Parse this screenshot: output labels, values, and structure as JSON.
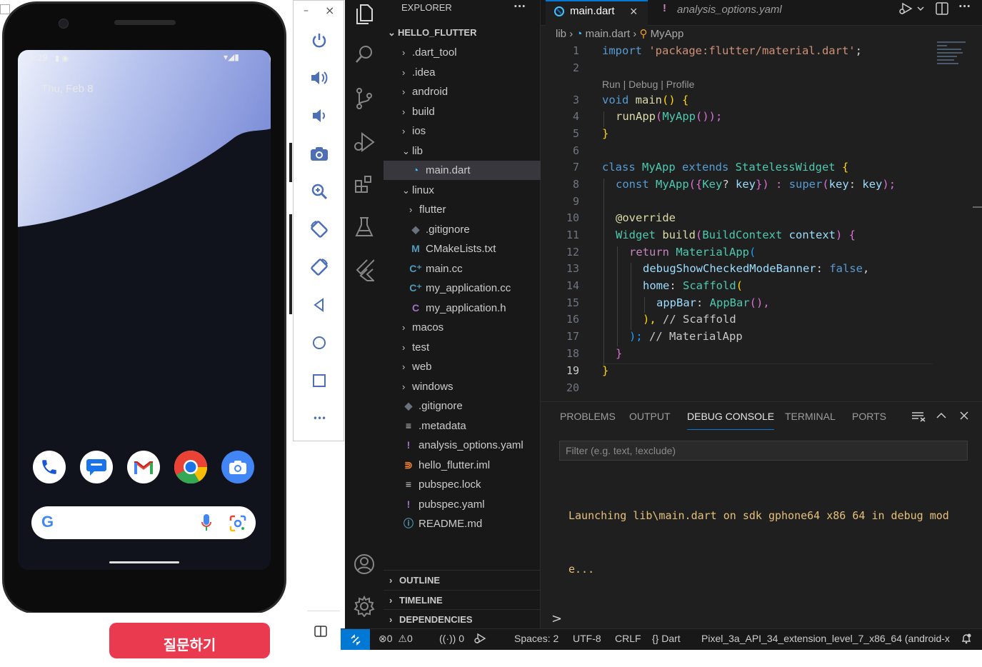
{
  "phone": {
    "status_time": "3:29",
    "date": "Thu, Feb 8",
    "ask_button": "질문하기",
    "dock": [
      "phone-icon",
      "messages-icon",
      "gmail-icon",
      "chrome-icon",
      "camera-icon"
    ]
  },
  "emulator_toolbar": {
    "minimize": "–",
    "close": "×",
    "more": "•••"
  },
  "vscode": {
    "explorer_title": "EXPLORER",
    "explorer_more": "···",
    "project": "HELLO_FLUTTER",
    "tree": [
      {
        "label": ".dart_tool",
        "type": "folder",
        "open": false,
        "depth": 0
      },
      {
        "label": ".idea",
        "type": "folder",
        "open": false,
        "depth": 0
      },
      {
        "label": "android",
        "type": "folder",
        "open": false,
        "depth": 0
      },
      {
        "label": "build",
        "type": "folder",
        "open": false,
        "depth": 0
      },
      {
        "label": "ios",
        "type": "folder",
        "open": false,
        "depth": 0
      },
      {
        "label": "lib",
        "type": "folder",
        "open": true,
        "depth": 0
      },
      {
        "label": "main.dart",
        "type": "dart",
        "depth": 1,
        "selected": true
      },
      {
        "label": "linux",
        "type": "folder",
        "open": true,
        "depth": 0
      },
      {
        "label": "flutter",
        "type": "folder",
        "open": false,
        "depth": 1
      },
      {
        "label": ".gitignore",
        "type": "git",
        "depth": 1
      },
      {
        "label": "CMakeLists.txt",
        "type": "cmake",
        "depth": 1
      },
      {
        "label": "main.cc",
        "type": "cpp",
        "depth": 1
      },
      {
        "label": "my_application.cc",
        "type": "cpp",
        "depth": 1
      },
      {
        "label": "my_application.h",
        "type": "c",
        "depth": 1
      },
      {
        "label": "macos",
        "type": "folder",
        "open": false,
        "depth": 0
      },
      {
        "label": "test",
        "type": "folder",
        "open": false,
        "depth": 0
      },
      {
        "label": "web",
        "type": "folder",
        "open": false,
        "depth": 0
      },
      {
        "label": "windows",
        "type": "folder",
        "open": false,
        "depth": 0
      },
      {
        "label": ".gitignore",
        "type": "git",
        "depth": 0
      },
      {
        "label": ".metadata",
        "type": "text",
        "depth": 0
      },
      {
        "label": "analysis_options.yaml",
        "type": "yaml",
        "depth": 0
      },
      {
        "label": "hello_flutter.iml",
        "type": "rss",
        "depth": 0
      },
      {
        "label": "pubspec.lock",
        "type": "text",
        "depth": 0
      },
      {
        "label": "pubspec.yaml",
        "type": "yaml",
        "depth": 0
      },
      {
        "label": "README.md",
        "type": "info",
        "depth": 0
      }
    ],
    "sections": [
      "OUTLINE",
      "TIMELINE",
      "DEPENDENCIES"
    ],
    "tabs": [
      {
        "label": "main.dart",
        "active": true,
        "close": "×"
      },
      {
        "label": "analysis_options.yaml",
        "active": false
      }
    ],
    "breadcrumb": {
      "folder": "lib",
      "file": "main.dart",
      "symbol": "MyApp"
    },
    "codelens": "Run | Debug | Profile",
    "line_numbers": [
      "1",
      "2",
      "3",
      "4",
      "5",
      "6",
      "7",
      "8",
      "9",
      "10",
      "11",
      "12",
      "13",
      "14",
      "15",
      "16",
      "17",
      "18",
      "19",
      "20"
    ],
    "current_line": "19",
    "code": {
      "l1a": "import ",
      "l1b": "'package:flutter/material.dart'",
      "l1c": ";",
      "l3a": "void ",
      "l3b": "main",
      "l3c": "() {",
      "l4a": "runApp",
      "l4b": "(",
      "l4c": "MyApp",
      "l4d": "());",
      "l5": "}",
      "l7a": "class ",
      "l7b": "MyApp ",
      "l7c": "extends ",
      "l7d": "StatelessWidget ",
      "l7e": "{",
      "l8a": "const ",
      "l8b": "MyApp",
      "l8c": "({",
      "l8d": "Key",
      "l8e": "? ",
      "l8f": "key",
      "l8g": "}) : ",
      "l8h": "super",
      "l8i": "(",
      "l8j": "key",
      "l8k": ": ",
      "l8l": "key",
      "l8m": ");",
      "l10": "@override",
      "l11a": "Widget ",
      "l11b": "build",
      "l11c": "(",
      "l11d": "BuildContext ",
      "l11e": "context",
      "l11f": ") {",
      "l12a": "return ",
      "l12b": "MaterialApp",
      "l12c": "(",
      "l13a": "debugShowCheckedModeBanner",
      "l13b": ": ",
      "l13c": "false",
      "l13d": ",",
      "l14a": "home",
      "l14b": ": ",
      "l14c": "Scaffold",
      "l14d": "(",
      "l15a": "appBar",
      "l15b": ": ",
      "l15c": "AppBar",
      "l15d": "(),",
      "l16a": "), ",
      "l16b": "// Scaffold",
      "l17a": "); ",
      "l17b": "// MaterialApp",
      "l18": "}",
      "l19": "}"
    },
    "panel_tabs": [
      "PROBLEMS",
      "OUTPUT",
      "DEBUG CONSOLE",
      "TERMINAL",
      "PORTS"
    ],
    "active_panel": "DEBUG CONSOLE",
    "filter_placeholder": "Filter (e.g. text, !exclude)",
    "console_line1": "Launching lib\\main.dart on sdk gphone64 x86 64 in debug mod",
    "console_line2": "e...",
    "prompt": ">",
    "status": {
      "errors": "0",
      "warnings": "0",
      "ports": "0",
      "spaces": "Spaces: 2",
      "encoding": "UTF-8",
      "eol": "CRLF",
      "language": "Dart",
      "braces": "{}",
      "device": "Pixel_3a_API_34_extension_level_7_x86_64 (android-x"
    }
  },
  "colors": {
    "vscode_bg": "#1f1f1f",
    "sidebar_bg": "#181818",
    "accent_blue": "#0078d4",
    "remote_bg": "#0078d4",
    "ask_red": "#ea3a50"
  }
}
